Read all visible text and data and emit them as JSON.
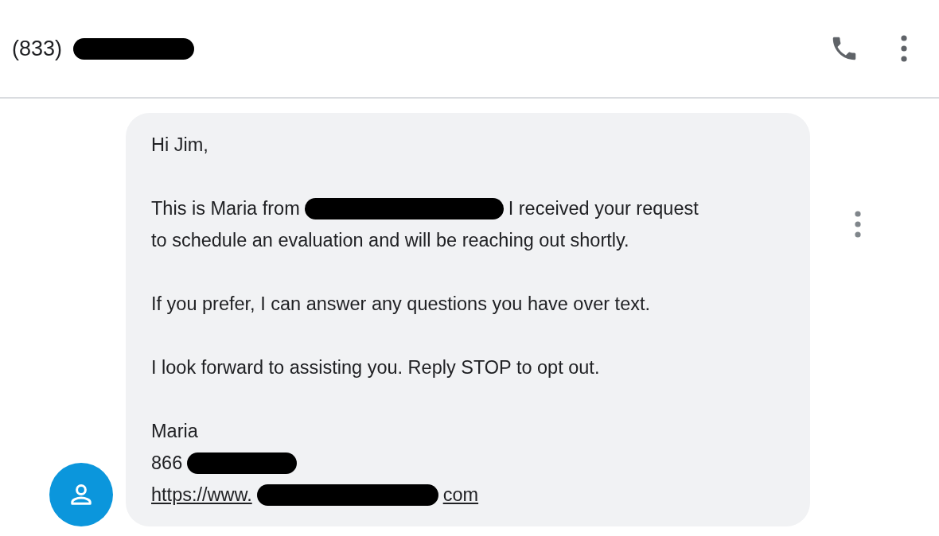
{
  "header": {
    "title": [
      {
        "kind": "text",
        "text": "(833)"
      },
      {
        "kind": "redaction"
      }
    ]
  },
  "message": {
    "paragraphs": [
      [
        {
          "kind": "line",
          "parts": [
            {
              "kind": "text",
              "text": "Hi Jim,"
            }
          ]
        }
      ],
      [
        {
          "kind": "line",
          "parts": [
            {
              "kind": "text",
              "text": "This is Maria from"
            },
            {
              "kind": "redaction"
            },
            {
              "kind": "text",
              "text": "I received your request"
            }
          ]
        },
        {
          "kind": "line",
          "parts": [
            {
              "kind": "text",
              "text": "to schedule an evaluation and will be reaching out shortly."
            }
          ]
        }
      ],
      [
        {
          "kind": "line",
          "parts": [
            {
              "kind": "text",
              "text": "If you prefer, I can answer any questions you have over text."
            }
          ]
        }
      ],
      [
        {
          "kind": "line",
          "parts": [
            {
              "kind": "text",
              "text": "I look forward to assisting you. Reply STOP to opt out."
            }
          ]
        }
      ],
      [
        {
          "kind": "line",
          "parts": [
            {
              "kind": "text",
              "text": "Maria"
            }
          ]
        },
        {
          "kind": "line",
          "parts": [
            {
              "kind": "text",
              "text": "866"
            },
            {
              "kind": "redaction"
            }
          ]
        },
        {
          "kind": "link",
          "parts": [
            {
              "kind": "text",
              "text": "https://www."
            },
            {
              "kind": "redaction"
            },
            {
              "kind": "text",
              "text": "com"
            }
          ]
        }
      ]
    ]
  }
}
